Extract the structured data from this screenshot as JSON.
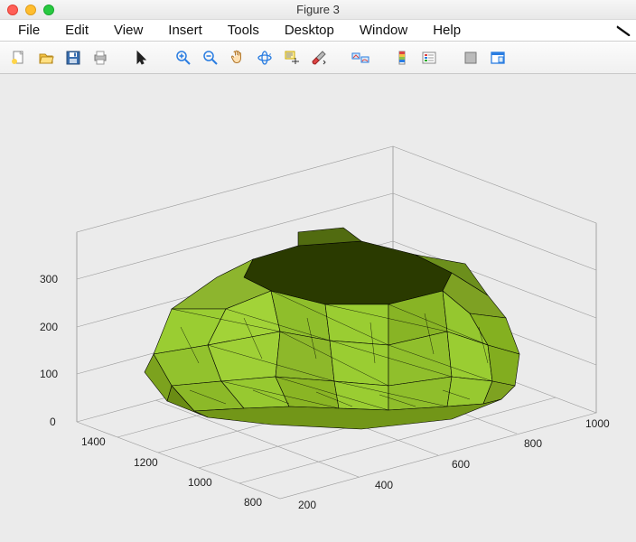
{
  "window": {
    "title": "Figure 3"
  },
  "menu": {
    "items": [
      "File",
      "Edit",
      "View",
      "Insert",
      "Tools",
      "Desktop",
      "Window",
      "Help"
    ]
  },
  "toolbar": {
    "buttons": [
      {
        "name": "new-figure",
        "icon": "new-icon"
      },
      {
        "name": "open",
        "icon": "open-icon"
      },
      {
        "name": "save",
        "icon": "save-icon"
      },
      {
        "name": "print",
        "icon": "print-icon"
      },
      {
        "sep": true
      },
      {
        "name": "pointer",
        "icon": "pointer-icon"
      },
      {
        "sep": true
      },
      {
        "name": "zoom-in",
        "icon": "zoom-in-icon"
      },
      {
        "name": "zoom-out",
        "icon": "zoom-out-icon"
      },
      {
        "name": "pan",
        "icon": "pan-icon"
      },
      {
        "name": "rotate-3d",
        "icon": "rotate-3d-icon"
      },
      {
        "name": "data-cursor",
        "icon": "data-cursor-icon"
      },
      {
        "name": "brush",
        "icon": "brush-icon"
      },
      {
        "sep": true
      },
      {
        "name": "link",
        "icon": "link-icon"
      },
      {
        "sep": true
      },
      {
        "name": "colorbar",
        "icon": "colorbar-icon"
      },
      {
        "name": "legend",
        "icon": "legend-icon"
      },
      {
        "sep": true
      },
      {
        "name": "hide-tools",
        "icon": "square-icon"
      },
      {
        "name": "dock",
        "icon": "dock-icon"
      }
    ]
  },
  "chart_data": {
    "type": "surface3d",
    "description": "Triangulated 3D mesh surface (yellow-green faces, black edges) resembling an irregular mound/rock shape",
    "x_axis": {
      "range": [
        800,
        1400
      ],
      "ticks": [
        800,
        1000,
        1200,
        1400
      ]
    },
    "y_axis": {
      "range": [
        200,
        1000
      ],
      "ticks": [
        200,
        400,
        600,
        800,
        1000
      ]
    },
    "z_axis": {
      "range": [
        0,
        300
      ],
      "ticks": [
        0,
        100,
        200,
        300
      ]
    },
    "face_color": "#9acd32",
    "edge_color": "#000000",
    "shading": "dark-top",
    "grid": true,
    "box": true
  }
}
